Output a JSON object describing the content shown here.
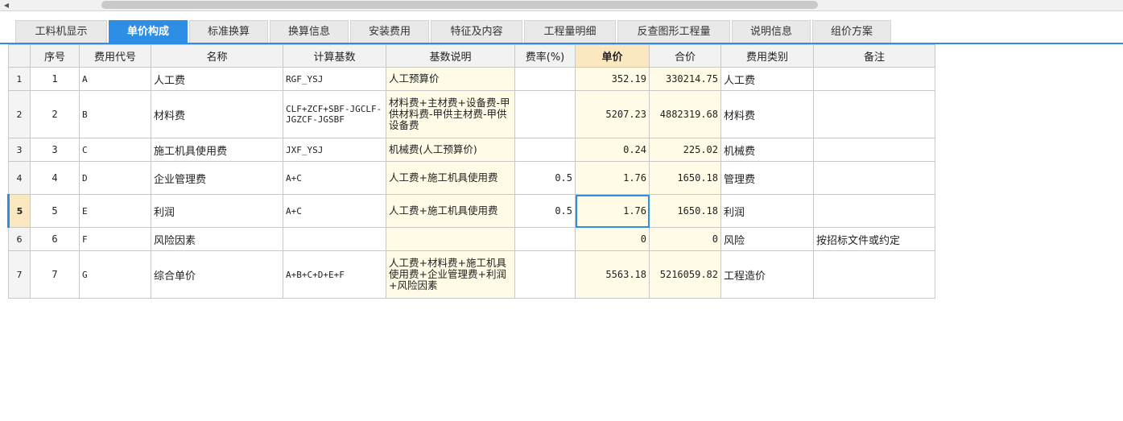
{
  "tabs": [
    {
      "label": "工料机显示"
    },
    {
      "label": "单价构成"
    },
    {
      "label": "标准换算"
    },
    {
      "label": "换算信息"
    },
    {
      "label": "安装费用"
    },
    {
      "label": "特征及内容"
    },
    {
      "label": "工程量明细"
    },
    {
      "label": "反查图形工程量"
    },
    {
      "label": "说明信息"
    },
    {
      "label": "组价方案"
    }
  ],
  "active_tab": "单价构成",
  "colors": {
    "accent": "#2e8ee6",
    "highlight": "#fbe7c0",
    "cell_yellow": "#fffbe6"
  },
  "table": {
    "headers": {
      "seq": "序号",
      "code": "费用代号",
      "name": "名称",
      "basis": "计算基数",
      "desc": "基数说明",
      "rate": "费率(%)",
      "price": "单价",
      "total": "合价",
      "ctype": "费用类别",
      "note": "备注"
    },
    "rows": [
      {
        "row": "1",
        "seq": "1",
        "code": "A",
        "name": "人工费",
        "basis": "RGF_YSJ",
        "desc": "人工预算价",
        "rate": "",
        "price": "352.19",
        "total": "330214.75",
        "ctype": "人工费",
        "note": ""
      },
      {
        "row": "2",
        "seq": "2",
        "code": "B",
        "name": "材料费",
        "basis": "CLF+ZCF+SBF-JGCLF-JGZCF-JGSBF",
        "desc": "材料费+主材费+设备费-甲供材料费-甲供主材费-甲供设备费",
        "rate": "",
        "price": "5207.23",
        "total": "4882319.68",
        "ctype": "材料费",
        "note": ""
      },
      {
        "row": "3",
        "seq": "3",
        "code": "C",
        "name": "施工机具使用费",
        "basis": "JXF_YSJ",
        "desc": "机械费(人工预算价)",
        "rate": "",
        "price": "0.24",
        "total": "225.02",
        "ctype": "机械费",
        "note": ""
      },
      {
        "row": "4",
        "seq": "4",
        "code": "D",
        "name": "企业管理费",
        "basis": "A+C",
        "desc": "人工费+施工机具使用费",
        "rate": "0.5",
        "price": "1.76",
        "total": "1650.18",
        "ctype": "管理费",
        "note": ""
      },
      {
        "row": "5",
        "seq": "5",
        "code": "E",
        "name": "利润",
        "basis": "A+C",
        "desc": "人工费+施工机具使用费",
        "rate": "0.5",
        "price": "1.76",
        "total": "1650.18",
        "ctype": "利润",
        "note": ""
      },
      {
        "row": "6",
        "seq": "6",
        "code": "F",
        "name": "风险因素",
        "basis": "",
        "desc": "",
        "rate": "",
        "price": "0",
        "total": "0",
        "ctype": "风险",
        "note": "按招标文件或约定"
      },
      {
        "row": "7",
        "seq": "7",
        "code": "G",
        "name": "综合单价",
        "basis": "A+B+C+D+E+F",
        "desc": "人工费+材料费+施工机具使用费+企业管理费+利润+风险因素",
        "rate": "",
        "price": "5563.18",
        "total": "5216059.82",
        "ctype": "工程造价",
        "note": ""
      }
    ]
  }
}
